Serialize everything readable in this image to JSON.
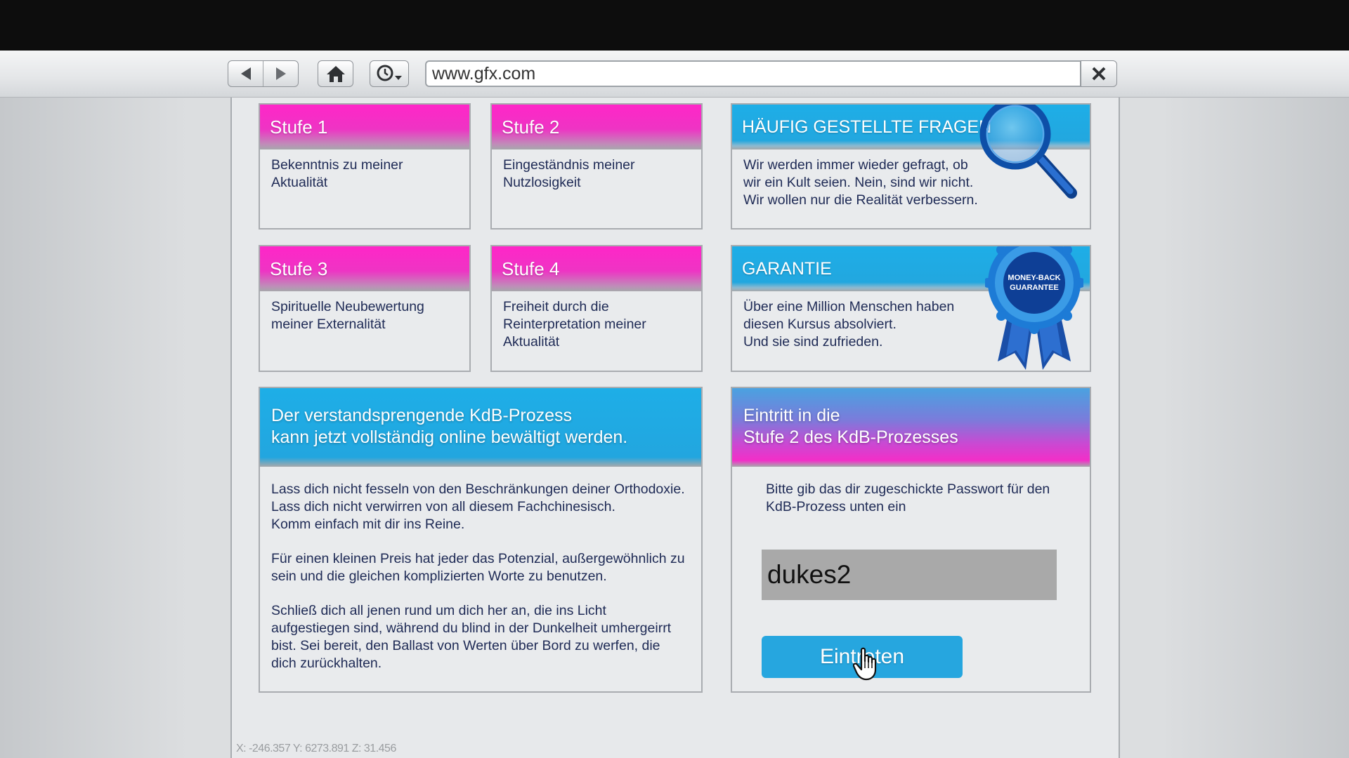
{
  "browser": {
    "url": "www.gfx.com",
    "icons": {
      "back": "back-arrow-icon",
      "forward": "forward-arrow-icon",
      "home": "home-icon",
      "history": "history-clock-icon",
      "close": "close-icon"
    }
  },
  "steps": [
    {
      "title": "Stufe 1",
      "lines": [
        "Bekenntnis zu meiner",
        "Aktualität"
      ]
    },
    {
      "title": "Stufe 2",
      "lines": [
        "Eingeständnis meiner",
        "Nutzlosigkeit"
      ]
    },
    {
      "title": "Stufe 3",
      "lines": [
        "Spirituelle Neubewertung",
        "meiner Externalität"
      ]
    },
    {
      "title": "Stufe 4",
      "lines": [
        "Freiheit durch die",
        "Reinterpretation meiner",
        "Aktualität"
      ]
    }
  ],
  "faq": {
    "title": "HÄUFIG GESTELLTE FRAGEN",
    "lines": [
      "Wir werden immer wieder gefragt, ob",
      "wir ein Kult seien. Nein, sind wir nicht.",
      "Wir wollen nur die Realität verbessern."
    ],
    "icon": "magnifying-glass-icon"
  },
  "guarantee": {
    "title": "GARANTIE",
    "lines": [
      "Über eine Million Menschen haben",
      "diesen Kursus absolviert.",
      "Und sie sind zufrieden."
    ],
    "badge_line1": "MONEY-BACK",
    "badge_line2": "GUARANTEE"
  },
  "process": {
    "head_lines": [
      "Der verstandsprengende KdB-Prozess",
      "kann jetzt vollständig online bewältigt werden."
    ],
    "para1": [
      "Lass dich nicht fesseln von den Beschränkungen deiner Orthodoxie.",
      "Lass dich nicht verwirren von all diesem Fachchinesisch.",
      "Komm einfach mit dir ins Reine."
    ],
    "para2": [
      "Für einen kleinen Preis hat jeder das Potenzial, außergewöhnlich zu",
      "sein und die gleichen komplizierten Worte zu benutzen."
    ],
    "para3": [
      "Schließ dich all jenen rund um dich her an, die ins Licht",
      "aufgestiegen sind, während du blind in der Dunkelheit umhergeirrt",
      "bist. Sei bereit, den Ballast von Werten über Bord zu werfen, die",
      "dich zurückhalten."
    ]
  },
  "login": {
    "head_lines": [
      "Eintritt in die",
      "Stufe 2 des KdB-Prozesses"
    ],
    "instruction_lines": [
      "Bitte gib das dir zugeschickte Passwort für den",
      "KdB-Prozess unten ein"
    ],
    "password_value": "dukes2",
    "button_label": "Eintreten",
    "button_color": "#26a6df"
  },
  "debug_coords": "X: -246.357 Y: 6273.891 Z: 31.456",
  "colors": {
    "pink": "#ff26c8",
    "blue": "#1eaee7",
    "text": "#1e2a55"
  }
}
